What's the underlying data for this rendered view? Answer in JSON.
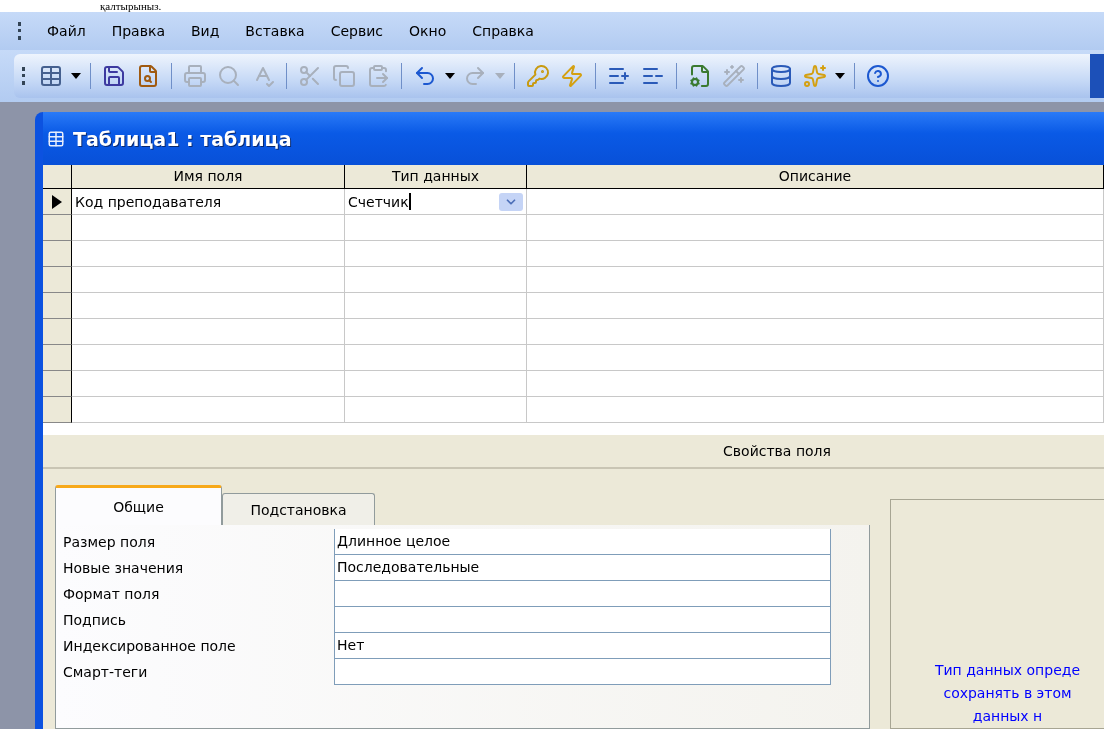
{
  "caption": "қалтырыныз.",
  "menu": [
    {
      "label": "Файл"
    },
    {
      "label": "Правка"
    },
    {
      "label": "Вид"
    },
    {
      "label": "Вставка"
    },
    {
      "label": "Сервис"
    },
    {
      "label": "Окно"
    },
    {
      "label": "Справка"
    }
  ],
  "toolbar": {
    "buttons": [
      {
        "disabled": false
      },
      {
        "disabled": false
      },
      {
        "disabled": false
      },
      {
        "disabled": true
      },
      {
        "disabled": true
      },
      {
        "disabled": true
      },
      {
        "disabled": true
      },
      {
        "disabled": true
      },
      {
        "disabled": true
      },
      {
        "disabled": false
      },
      {
        "disabled": true
      },
      {
        "disabled": false
      },
      {
        "disabled": false
      },
      {
        "disabled": false
      },
      {
        "disabled": false
      },
      {
        "disabled": false
      },
      {
        "disabled": true
      },
      {
        "disabled": false
      },
      {
        "disabled": false
      },
      {
        "disabled": false
      }
    ]
  },
  "window": {
    "title": "Таблица1 : таблица"
  },
  "table": {
    "columns": [
      "Имя поля",
      "Тип данных",
      "Описание"
    ],
    "rows": [
      {
        "current": true,
        "name": "Код преподавателя",
        "type": "Счетчик"
      },
      {},
      {},
      {},
      {},
      {},
      {},
      {},
      {}
    ]
  },
  "properties": {
    "heading": "Свойства поля",
    "tabs": [
      {
        "label": "Общие",
        "selected": true
      },
      {
        "label": "Подстановка",
        "selected": false
      }
    ],
    "rows": [
      {
        "label": "Размер поля",
        "value": "Длинное целое"
      },
      {
        "label": "Новые значения",
        "value": "Последовательные"
      },
      {
        "label": "Формат поля"
      },
      {
        "label": "Подпись"
      },
      {
        "label": "Индексированное поле",
        "value": "Нет"
      },
      {
        "label": "Смарт-теги"
      }
    ],
    "help": [
      "Тип данных опреде",
      "сохранять в этом",
      "данных н"
    ]
  }
}
